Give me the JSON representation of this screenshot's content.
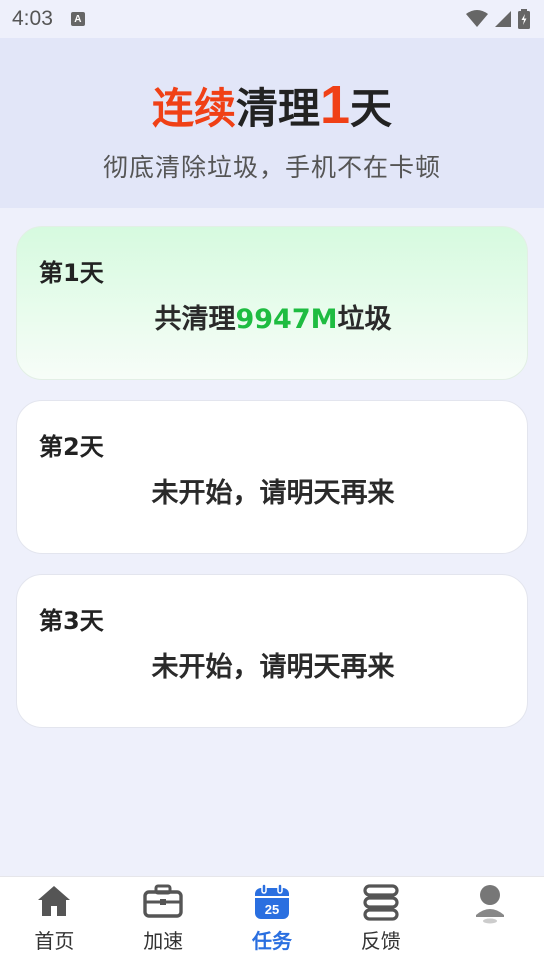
{
  "status_bar": {
    "time": "4:03",
    "notification_icon_letter": "A",
    "icons": [
      "wifi-icon",
      "signal-icon",
      "battery-icon"
    ]
  },
  "header": {
    "title_red": "连续",
    "title_mid": "清理",
    "title_count": "1",
    "title_end": "天",
    "subtitle": "彻底清除垃圾，手机不在卡顿"
  },
  "days": [
    {
      "label": "第1天",
      "msg_prefix": "共清理",
      "msg_value": "9947M",
      "msg_suffix": "垃圾",
      "status": "done"
    },
    {
      "label": "第2天",
      "msg": "未开始，请明天再来",
      "status": "pending"
    },
    {
      "label": "第3天",
      "msg": "未开始，请明天再来",
      "status": "pending"
    }
  ],
  "nav": {
    "items": [
      {
        "label": "首页",
        "icon": "home-icon"
      },
      {
        "label": "加速",
        "icon": "briefcase-icon"
      },
      {
        "label": "任务",
        "icon": "calendar-icon",
        "badge": "25",
        "active": true
      },
      {
        "label": "反馈",
        "icon": "server-icon"
      },
      {
        "label": "",
        "icon": "user-icon"
      }
    ]
  },
  "colors": {
    "accent_red": "#f04016",
    "accent_green": "#1ebc41",
    "nav_active": "#2a6fe0",
    "header_bg": "#e2e6f8"
  }
}
